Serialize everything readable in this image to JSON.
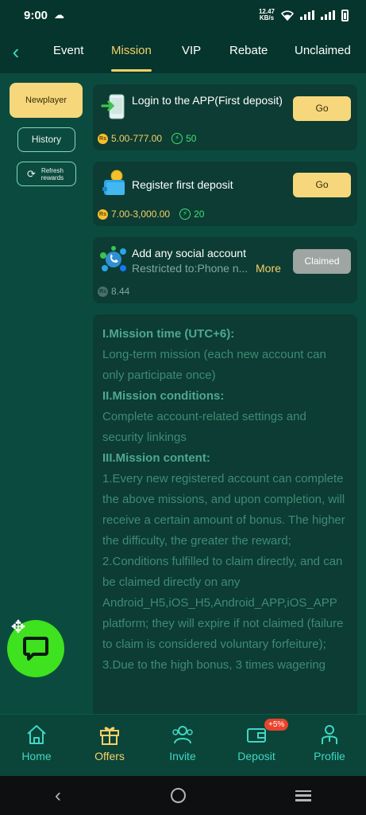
{
  "status_bar": {
    "time": "9:00",
    "speed_value": "12.47",
    "speed_unit": "KB/s"
  },
  "top_nav": {
    "tabs": [
      {
        "label": "Event"
      },
      {
        "label": "Mission",
        "active": true
      },
      {
        "label": "VIP"
      },
      {
        "label": "Rebate"
      },
      {
        "label": "Unclaimed"
      }
    ]
  },
  "side_menu": {
    "newplayer": "Newplayer",
    "history": "History",
    "refresh": "Refresh rewards"
  },
  "missions": [
    {
      "title": "Login to the APP(First deposit)",
      "reward_range": "5.00-777.00",
      "points": "50",
      "button": "Go",
      "icon": "phone-login-icon"
    },
    {
      "title": "Register first deposit",
      "reward_range": "7.00-3,000.00",
      "points": "20",
      "button": "Go",
      "icon": "wallet-coin-icon"
    },
    {
      "title": "Add any social account",
      "subtitle": "Restricted to:Phone n...",
      "more": "More",
      "reward": "8.44",
      "button": "Claimed",
      "icon": "social-network-icon"
    }
  ],
  "currency_symbol": "Rs",
  "rules": {
    "h1": "I.Mission time (UTC+6):",
    "p1": "Long-term mission (each new account can only participate once)",
    "h2": "II.Mission conditions:",
    "p2": "Complete account-related settings and security linkings",
    "h3": "III.Mission content:",
    "p3": "1.Every new registered account can complete the above missions, and upon completion, will receive a certain amount of bonus. The higher the difficulty, the greater the reward;",
    "p4": "2.Conditions fulfilled to claim directly, and can be claimed directly on any Android_H5,iOS_H5,Android_APP,iOS_APP platform; they will expire if not claimed (failure to claim is considered voluntary forfeiture);",
    "p5": "3.Due to the high bonus, 3 times wagering"
  },
  "bottom_nav": {
    "items": [
      {
        "label": "Home"
      },
      {
        "label": "Offers",
        "active": true
      },
      {
        "label": "Invite"
      },
      {
        "label": "Deposit",
        "badge": "+5%"
      },
      {
        "label": "Profile"
      }
    ]
  },
  "colors": {
    "accent": "#f5d06a",
    "background": "#0b4b3f",
    "card": "#0c3c33",
    "teal": "#3fd7c4",
    "chat_green": "#3ee21e"
  }
}
